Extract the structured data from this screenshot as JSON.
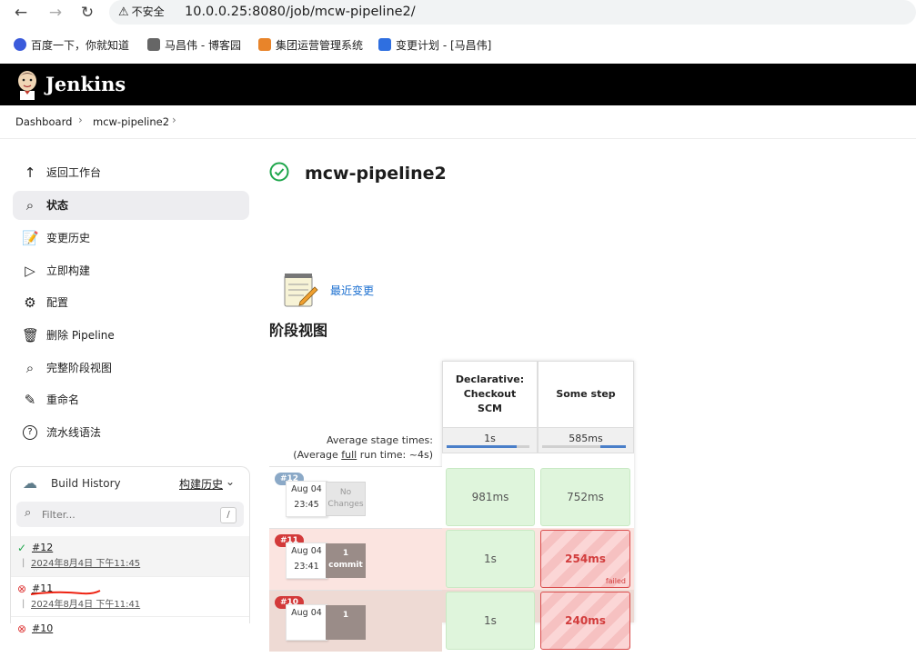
{
  "browser": {
    "insecure_label": "不安全",
    "url": "10.0.0.25:8080/job/mcw-pipeline2/",
    "bookmarks": [
      {
        "label": "百度一下，你就知道",
        "color": "#3b5bdb"
      },
      {
        "label": "马昌伟 - 博客园",
        "color": "#555555"
      },
      {
        "label": "集团运营管理系统",
        "color": "#e8842a"
      },
      {
        "label": "变更计划 - [马昌伟]",
        "color": "#2f6fe0"
      }
    ]
  },
  "header": {
    "title": "Jenkins"
  },
  "breadcrumb": [
    "Dashboard",
    "mcw-pipeline2"
  ],
  "sidebar": {
    "items": [
      {
        "label": "返回工作台",
        "icon": "arrow-up-icon"
      },
      {
        "label": "状态",
        "icon": "search-icon"
      },
      {
        "label": "变更历史",
        "icon": "notepad-icon"
      },
      {
        "label": "立即构建",
        "icon": "play-icon"
      },
      {
        "label": "配置",
        "icon": "gear-icon"
      },
      {
        "label": "删除 Pipeline",
        "icon": "trash-icon"
      },
      {
        "label": "完整阶段视图",
        "icon": "search-icon"
      },
      {
        "label": "重命名",
        "icon": "pencil-icon"
      },
      {
        "label": "流水线语法",
        "icon": "help-icon"
      }
    ]
  },
  "build_history": {
    "title": "Build History",
    "trend_label": "构建历史",
    "filter_placeholder": "Filter...",
    "slash_key": "/",
    "builds": [
      {
        "number": "#12",
        "date": "2024年8月4日 下午11:45",
        "status": "success"
      },
      {
        "number": "#11",
        "date": "2024年8月4日 下午11:41",
        "status": "failed"
      },
      {
        "number": "#10",
        "date": "",
        "status": "failed"
      }
    ]
  },
  "main": {
    "job_title": "mcw-pipeline2",
    "recent_changes_link": "最近变更",
    "stage_view_title": "阶段视图"
  },
  "stage_view": {
    "stages": [
      {
        "name": "Declarative: Checkout SCM",
        "avg": "1s",
        "avg_fraction": 0.85
      },
      {
        "name": "Some step",
        "avg": "585ms",
        "avg_fraction": 0.3
      }
    ],
    "avg_label_1": "Average stage times:",
    "avg_label_2_pre": "(Average ",
    "avg_label_2_link": "full",
    "avg_label_2_post": " run time: ~4s)",
    "runs": [
      {
        "badge": "#12",
        "date": "Aug 04",
        "time": "23:45",
        "changes_line1": "No",
        "changes_line2": "Changes",
        "status": "success",
        "cells": [
          {
            "value": "981ms",
            "status": "ok"
          },
          {
            "value": "752ms",
            "status": "ok"
          }
        ]
      },
      {
        "badge": "#11",
        "date": "Aug 04",
        "time": "23:41",
        "changes_line1": "1",
        "changes_line2": "commit",
        "status": "failed",
        "cells": [
          {
            "value": "1s",
            "status": "ok"
          },
          {
            "value": "254ms",
            "status": "fail",
            "tag": "failed"
          }
        ]
      },
      {
        "badge": "#10",
        "date": "Aug 04",
        "time": "",
        "changes_line1": "1",
        "changes_line2": "",
        "status": "failed",
        "cells": [
          {
            "value": "1s",
            "status": "ok"
          },
          {
            "value": "240ms",
            "status": "fail"
          }
        ]
      }
    ]
  }
}
